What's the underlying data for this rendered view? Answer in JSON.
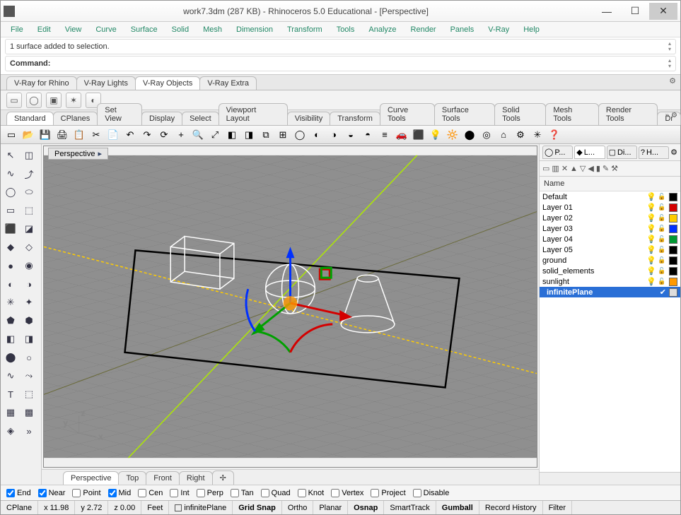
{
  "window": {
    "title": "work7.3dm (287 KB) - Rhinoceros 5.0 Educational - [Perspective]"
  },
  "menu": [
    "File",
    "Edit",
    "View",
    "Curve",
    "Surface",
    "Solid",
    "Mesh",
    "Dimension",
    "Transform",
    "Tools",
    "Analyze",
    "Render",
    "Panels",
    "V-Ray",
    "Help"
  ],
  "history_line": "1 surface added to selection.",
  "command_label": "Command:",
  "vray_tabs": [
    "V-Ray for Rhino",
    "V-Ray Lights",
    "V-Ray Objects",
    "V-Ray Extra"
  ],
  "vray_active_tab": 2,
  "toolbar_tabs": [
    "Standard",
    "CPlanes",
    "Set View",
    "Display",
    "Select",
    "Viewport Layout",
    "Visibility",
    "Transform",
    "Curve Tools",
    "Surface Tools",
    "Solid Tools",
    "Mesh Tools",
    "Render Tools",
    "Dr"
  ],
  "toolbar_more": ">>",
  "viewport_label": "Perspective",
  "view_tabs": [
    "Perspective",
    "Top",
    "Front",
    "Right"
  ],
  "view_active": 0,
  "right_tabs": [
    {
      "label": "P...",
      "icon": "◯"
    },
    {
      "label": "L...",
      "icon": "◆"
    },
    {
      "label": "Di...",
      "icon": "▢"
    },
    {
      "label": "H...",
      "icon": "?"
    }
  ],
  "right_active_tab": 1,
  "layer_header": "Name",
  "layers": [
    {
      "name": "Default",
      "color": "#000000"
    },
    {
      "name": "Layer 01",
      "color": "#d40000"
    },
    {
      "name": "Layer 02",
      "color": "#ffcc00"
    },
    {
      "name": "Layer 03",
      "color": "#0030ff"
    },
    {
      "name": "Layer 04",
      "color": "#009933"
    },
    {
      "name": "Layer 05",
      "color": "#000000"
    },
    {
      "name": "ground",
      "color": "#000000"
    },
    {
      "name": "solid_elements",
      "color": "#000000"
    },
    {
      "name": "sunlight",
      "color": "#ff9900"
    }
  ],
  "layer_selected": {
    "name": "infinitePlane",
    "checked": true,
    "color": "#dddddd"
  },
  "osnaps": [
    {
      "label": "End",
      "checked": true
    },
    {
      "label": "Near",
      "checked": true
    },
    {
      "label": "Point",
      "checked": false
    },
    {
      "label": "Mid",
      "checked": true
    },
    {
      "label": "Cen",
      "checked": false
    },
    {
      "label": "Int",
      "checked": false
    },
    {
      "label": "Perp",
      "checked": false
    },
    {
      "label": "Tan",
      "checked": false
    },
    {
      "label": "Quad",
      "checked": false
    },
    {
      "label": "Knot",
      "checked": false
    },
    {
      "label": "Vertex",
      "checked": false
    },
    {
      "label": "Project",
      "checked": false
    },
    {
      "label": "Disable",
      "checked": false
    }
  ],
  "status": {
    "plane": "CPlane",
    "x": "x 11.98",
    "y": "y 2.72",
    "z": "z 0.00",
    "units": "Feet",
    "layer": "infinitePlane",
    "toggles": [
      "Grid Snap",
      "Ortho",
      "Planar",
      "Osnap",
      "SmartTrack",
      "Gumball",
      "Record History",
      "Filter"
    ],
    "bold_toggles": [
      0,
      3,
      5
    ]
  },
  "axis_labels": {
    "x": "x",
    "y": "y",
    "z": "z"
  }
}
